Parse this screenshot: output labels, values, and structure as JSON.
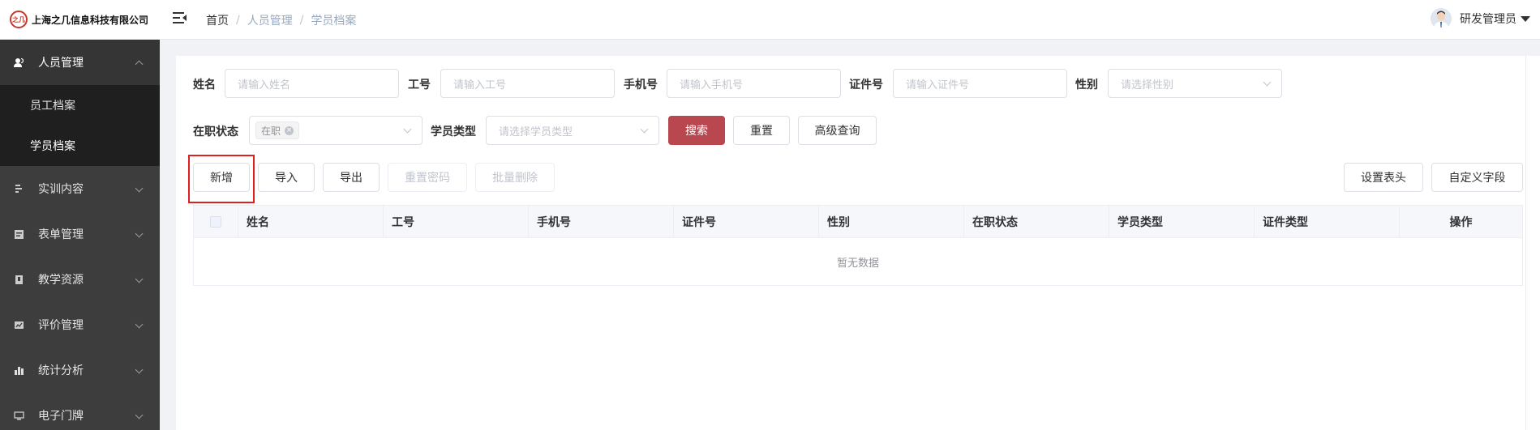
{
  "header": {
    "logo_mark": "之几",
    "company": "上海之几信息科技有限公司",
    "breadcrumb": [
      "首页",
      "人员管理",
      "学员档案"
    ],
    "user_name": "研发管理员"
  },
  "sidebar": {
    "items": [
      {
        "label": "人员管理",
        "icon": "people-icon",
        "active": true
      },
      {
        "label": "实训内容",
        "icon": "training-icon"
      },
      {
        "label": "表单管理",
        "icon": "form-icon"
      },
      {
        "label": "教学资源",
        "icon": "resource-icon"
      },
      {
        "label": "评价管理",
        "icon": "evaluation-icon"
      },
      {
        "label": "统计分析",
        "icon": "bar-chart-icon"
      },
      {
        "label": "电子门牌",
        "icon": "monitor-icon"
      }
    ],
    "submenu": [
      "员工档案",
      "学员档案"
    ]
  },
  "filters": {
    "name_label": "姓名",
    "name_placeholder": "请输入姓名",
    "job_no_label": "工号",
    "job_no_placeholder": "请输入工号",
    "phone_label": "手机号",
    "phone_placeholder": "请输入手机号",
    "id_label": "证件号",
    "id_placeholder": "请输入证件号",
    "gender_label": "性别",
    "gender_placeholder": "请选择性别",
    "status_label": "在职状态",
    "status_tag": "在职",
    "type_label": "学员类型",
    "type_placeholder": "请选择学员类型",
    "search": "搜索",
    "reset": "重置",
    "advanced": "高级查询"
  },
  "toolbar": {
    "add": "新增",
    "import": "导入",
    "export": "导出",
    "reset_password": "重置密码",
    "batch_delete": "批量删除",
    "set_header": "设置表头",
    "custom_field": "自定义字段"
  },
  "table": {
    "columns": [
      "姓名",
      "工号",
      "手机号",
      "证件号",
      "性别",
      "在职状态",
      "学员类型",
      "证件类型",
      "操作"
    ],
    "empty_text": "暂无数据"
  },
  "colors": {
    "primary": "#b8474f",
    "sidebar": "#3d3d3d",
    "highlight": "#e02020"
  }
}
